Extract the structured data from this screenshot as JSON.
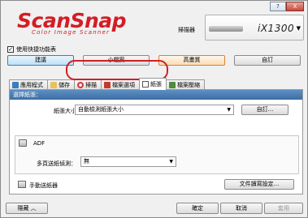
{
  "title_bar": {
    "help": "?",
    "close": "X"
  },
  "logo": {
    "main": "ScanSnap",
    "sub": "Color Image Scanner"
  },
  "scanner": {
    "label": "掃描器",
    "model": "iX1300"
  },
  "profile_checkbox": {
    "label": "使用快捷功能表",
    "checked": true
  },
  "profiles": [
    "建議",
    "小檔案",
    "高畫質",
    "自訂"
  ],
  "tabs": [
    {
      "label": "應用程式",
      "icon": "app-icon"
    },
    {
      "label": "儲存",
      "icon": "folder-icon"
    },
    {
      "label": "掃描",
      "icon": "scan-icon"
    },
    {
      "label": "檔案選項",
      "icon": "file-icon"
    },
    {
      "label": "紙張",
      "icon": "paper-icon"
    },
    {
      "label": "檔案壓縮",
      "icon": "compress-icon"
    }
  ],
  "paper_tab": {
    "section_title": "選擇紙張：",
    "paper_size_label": "紙張大小：",
    "paper_size_value": "自動檢測紙張大小",
    "detail_button": "自訂...",
    "adf_label": "ADF",
    "multifeed_label": "多頁送紙偵測：",
    "multifeed_value": "無",
    "manual_label": "手動送紙器",
    "doc_setting_button": "文件讀寫設定..."
  },
  "bottom": {
    "hide": "隱藏",
    "ok": "確定",
    "cancel": "取消",
    "apply": "套用"
  },
  "colors": {
    "brand": "#d21e25",
    "section_head": "#4a7db4",
    "highlight": "#d21e25"
  }
}
